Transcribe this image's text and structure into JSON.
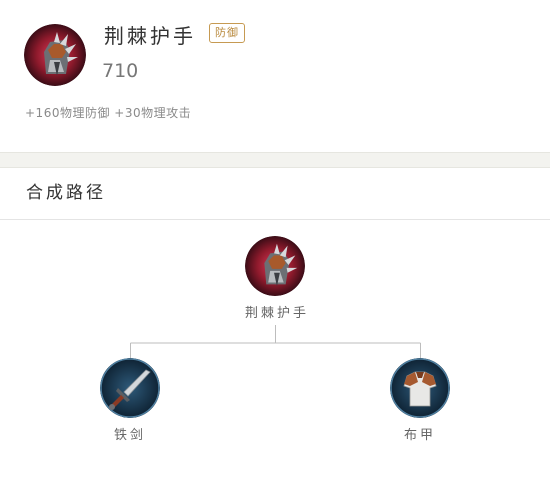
{
  "item": {
    "name": "荆棘护手",
    "tag": "防御",
    "price": "710",
    "stats": "+160物理防御 +30物理攻击",
    "icon": "spiked-gauntlet-icon"
  },
  "recipe": {
    "section_title": "合成路径",
    "root": {
      "label": "荆棘护手",
      "icon": "spiked-gauntlet-icon"
    },
    "components": [
      {
        "label": "铁剑",
        "icon": "iron-sword-icon"
      },
      {
        "label": "布甲",
        "icon": "cloth-armor-icon"
      }
    ]
  },
  "colors": {
    "tag_border": "#c69a52",
    "gauntlet_bg": "#8e1a2c",
    "component_bg": "#1d3a52"
  }
}
